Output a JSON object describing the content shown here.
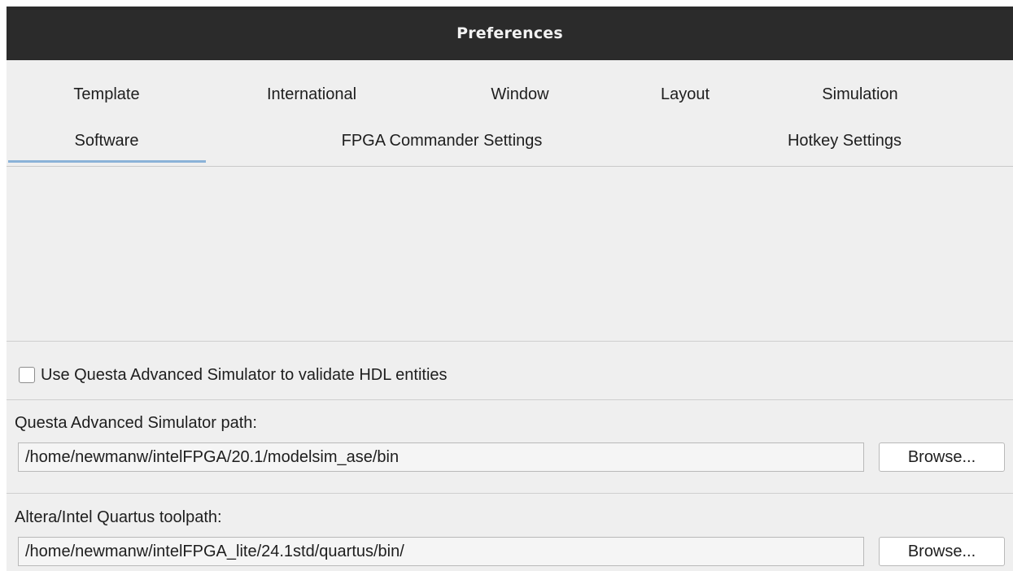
{
  "window": {
    "title": "Preferences"
  },
  "tabs": {
    "row1": [
      "Template",
      "International",
      "Window",
      "Layout",
      "Simulation"
    ],
    "row2": [
      "Software",
      "FPGA Commander Settings",
      "Hotkey Settings"
    ],
    "selected": "Software",
    "accent_color": "#8ab2d8"
  },
  "software": {
    "questa_validate": {
      "label": "Use Questa Advanced Simulator to validate HDL entities",
      "checked": false
    },
    "questa_path": {
      "label": "Questa Advanced Simulator path:",
      "value": "/home/newmanw/intelFPGA/20.1/modelsim_ase/bin",
      "browse_label": "Browse..."
    },
    "quartus_path": {
      "label": "Altera/Intel Quartus toolpath:",
      "value": "/home/newmanw/intelFPGA_lite/24.1std/quartus/bin/",
      "browse_label": "Browse..."
    }
  }
}
